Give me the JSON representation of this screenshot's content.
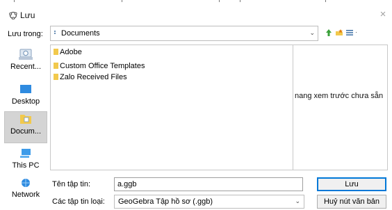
{
  "window": {
    "title": "Lưu",
    "close_glyph": "×"
  },
  "toolbar": {
    "look_in_label": "Lưu trong:",
    "look_in_value": "Documents",
    "dropdown_glyph": "⌄",
    "icons": [
      "up-one-level-icon",
      "new-folder-icon",
      "view-menu-icon"
    ]
  },
  "places": [
    {
      "label": "Recent...",
      "icon": "recent-icon"
    },
    {
      "label": "Desktop",
      "icon": "desktop-icon"
    },
    {
      "label": "Docum...",
      "icon": "documents-icon",
      "selected": true
    },
    {
      "label": "This PC",
      "icon": "this-pc-icon"
    },
    {
      "label": "Network",
      "icon": "network-icon"
    }
  ],
  "files": [
    {
      "name": "Adobe"
    },
    {
      "name": "Custom Office Templates"
    },
    {
      "name": "Zalo Received Files"
    }
  ],
  "preview": {
    "text": "nang xem trước chưa sẵn"
  },
  "form": {
    "filename_label": "Tên tập tin:",
    "filename_value": "a.ggb",
    "filetype_label": "Các tập tin loại:",
    "filetype_value": "GeoGebra Tập hồ sơ (.ggb)"
  },
  "buttons": {
    "save": "Lưu",
    "cancel": "Huỷ nút văn bản"
  },
  "colors": {
    "accent": "#0078d7",
    "folder": "#f2c94c",
    "selected_place": "#d4d4d4"
  }
}
